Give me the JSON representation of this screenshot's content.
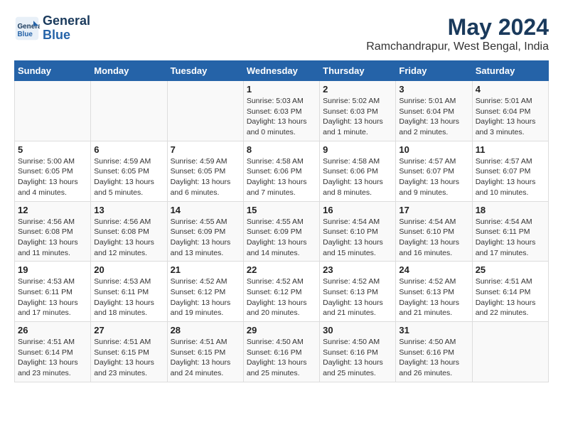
{
  "header": {
    "logo_line1": "General",
    "logo_line2": "Blue",
    "title": "May 2024",
    "subtitle": "Ramchandrapur, West Bengal, India"
  },
  "days_of_week": [
    "Sunday",
    "Monday",
    "Tuesday",
    "Wednesday",
    "Thursday",
    "Friday",
    "Saturday"
  ],
  "weeks": [
    [
      {
        "day": "",
        "info": ""
      },
      {
        "day": "",
        "info": ""
      },
      {
        "day": "",
        "info": ""
      },
      {
        "day": "1",
        "info": "Sunrise: 5:03 AM\nSunset: 6:03 PM\nDaylight: 13 hours\nand 0 minutes."
      },
      {
        "day": "2",
        "info": "Sunrise: 5:02 AM\nSunset: 6:03 PM\nDaylight: 13 hours\nand 1 minute."
      },
      {
        "day": "3",
        "info": "Sunrise: 5:01 AM\nSunset: 6:04 PM\nDaylight: 13 hours\nand 2 minutes."
      },
      {
        "day": "4",
        "info": "Sunrise: 5:01 AM\nSunset: 6:04 PM\nDaylight: 13 hours\nand 3 minutes."
      }
    ],
    [
      {
        "day": "5",
        "info": "Sunrise: 5:00 AM\nSunset: 6:05 PM\nDaylight: 13 hours\nand 4 minutes."
      },
      {
        "day": "6",
        "info": "Sunrise: 4:59 AM\nSunset: 6:05 PM\nDaylight: 13 hours\nand 5 minutes."
      },
      {
        "day": "7",
        "info": "Sunrise: 4:59 AM\nSunset: 6:05 PM\nDaylight: 13 hours\nand 6 minutes."
      },
      {
        "day": "8",
        "info": "Sunrise: 4:58 AM\nSunset: 6:06 PM\nDaylight: 13 hours\nand 7 minutes."
      },
      {
        "day": "9",
        "info": "Sunrise: 4:58 AM\nSunset: 6:06 PM\nDaylight: 13 hours\nand 8 minutes."
      },
      {
        "day": "10",
        "info": "Sunrise: 4:57 AM\nSunset: 6:07 PM\nDaylight: 13 hours\nand 9 minutes."
      },
      {
        "day": "11",
        "info": "Sunrise: 4:57 AM\nSunset: 6:07 PM\nDaylight: 13 hours\nand 10 minutes."
      }
    ],
    [
      {
        "day": "12",
        "info": "Sunrise: 4:56 AM\nSunset: 6:08 PM\nDaylight: 13 hours\nand 11 minutes."
      },
      {
        "day": "13",
        "info": "Sunrise: 4:56 AM\nSunset: 6:08 PM\nDaylight: 13 hours\nand 12 minutes."
      },
      {
        "day": "14",
        "info": "Sunrise: 4:55 AM\nSunset: 6:09 PM\nDaylight: 13 hours\nand 13 minutes."
      },
      {
        "day": "15",
        "info": "Sunrise: 4:55 AM\nSunset: 6:09 PM\nDaylight: 13 hours\nand 14 minutes."
      },
      {
        "day": "16",
        "info": "Sunrise: 4:54 AM\nSunset: 6:10 PM\nDaylight: 13 hours\nand 15 minutes."
      },
      {
        "day": "17",
        "info": "Sunrise: 4:54 AM\nSunset: 6:10 PM\nDaylight: 13 hours\nand 16 minutes."
      },
      {
        "day": "18",
        "info": "Sunrise: 4:54 AM\nSunset: 6:11 PM\nDaylight: 13 hours\nand 17 minutes."
      }
    ],
    [
      {
        "day": "19",
        "info": "Sunrise: 4:53 AM\nSunset: 6:11 PM\nDaylight: 13 hours\nand 17 minutes."
      },
      {
        "day": "20",
        "info": "Sunrise: 4:53 AM\nSunset: 6:11 PM\nDaylight: 13 hours\nand 18 minutes."
      },
      {
        "day": "21",
        "info": "Sunrise: 4:52 AM\nSunset: 6:12 PM\nDaylight: 13 hours\nand 19 minutes."
      },
      {
        "day": "22",
        "info": "Sunrise: 4:52 AM\nSunset: 6:12 PM\nDaylight: 13 hours\nand 20 minutes."
      },
      {
        "day": "23",
        "info": "Sunrise: 4:52 AM\nSunset: 6:13 PM\nDaylight: 13 hours\nand 21 minutes."
      },
      {
        "day": "24",
        "info": "Sunrise: 4:52 AM\nSunset: 6:13 PM\nDaylight: 13 hours\nand 21 minutes."
      },
      {
        "day": "25",
        "info": "Sunrise: 4:51 AM\nSunset: 6:14 PM\nDaylight: 13 hours\nand 22 minutes."
      }
    ],
    [
      {
        "day": "26",
        "info": "Sunrise: 4:51 AM\nSunset: 6:14 PM\nDaylight: 13 hours\nand 23 minutes."
      },
      {
        "day": "27",
        "info": "Sunrise: 4:51 AM\nSunset: 6:15 PM\nDaylight: 13 hours\nand 23 minutes."
      },
      {
        "day": "28",
        "info": "Sunrise: 4:51 AM\nSunset: 6:15 PM\nDaylight: 13 hours\nand 24 minutes."
      },
      {
        "day": "29",
        "info": "Sunrise: 4:50 AM\nSunset: 6:16 PM\nDaylight: 13 hours\nand 25 minutes."
      },
      {
        "day": "30",
        "info": "Sunrise: 4:50 AM\nSunset: 6:16 PM\nDaylight: 13 hours\nand 25 minutes."
      },
      {
        "day": "31",
        "info": "Sunrise: 4:50 AM\nSunset: 6:16 PM\nDaylight: 13 hours\nand 26 minutes."
      },
      {
        "day": "",
        "info": ""
      }
    ]
  ]
}
